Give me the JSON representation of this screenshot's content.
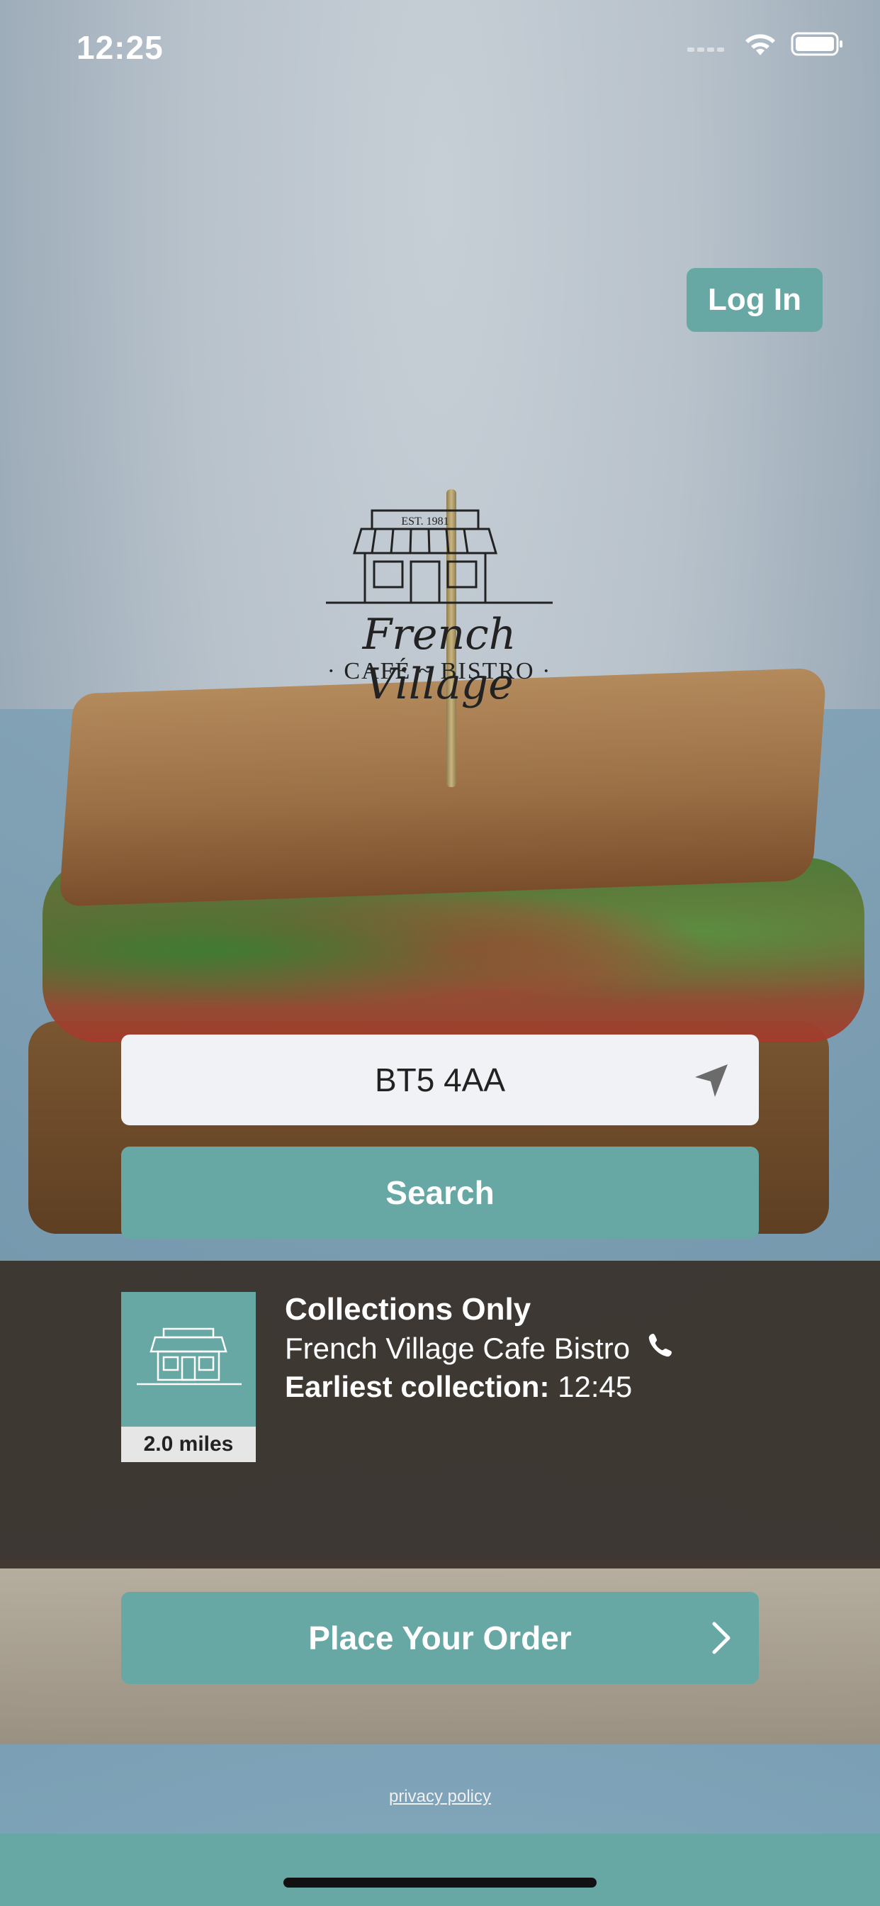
{
  "status_bar": {
    "time": "12:25"
  },
  "header": {
    "login_label": "Log In"
  },
  "logo": {
    "title": "French Village",
    "subtitle": "· CAFÉ ~ BISTRO ·",
    "est": "EST. 1981"
  },
  "search": {
    "value": "BT5 4AA",
    "button_label": "Search"
  },
  "store": {
    "distance": "2.0 miles",
    "type": "Collections Only",
    "name": "French Village Cafe Bistro",
    "earliest_label": "Earliest collection:",
    "earliest_time": "12:45"
  },
  "order": {
    "button_label": "Place Your Order"
  },
  "footer": {
    "privacy": "privacy policy"
  },
  "colors": {
    "accent": "#67a8a5",
    "panel": "#3a302a"
  },
  "icons": [
    "location-arrow-icon",
    "phone-icon",
    "chevron-right-icon",
    "wifi-icon",
    "battery-icon",
    "storefront-icon"
  ]
}
